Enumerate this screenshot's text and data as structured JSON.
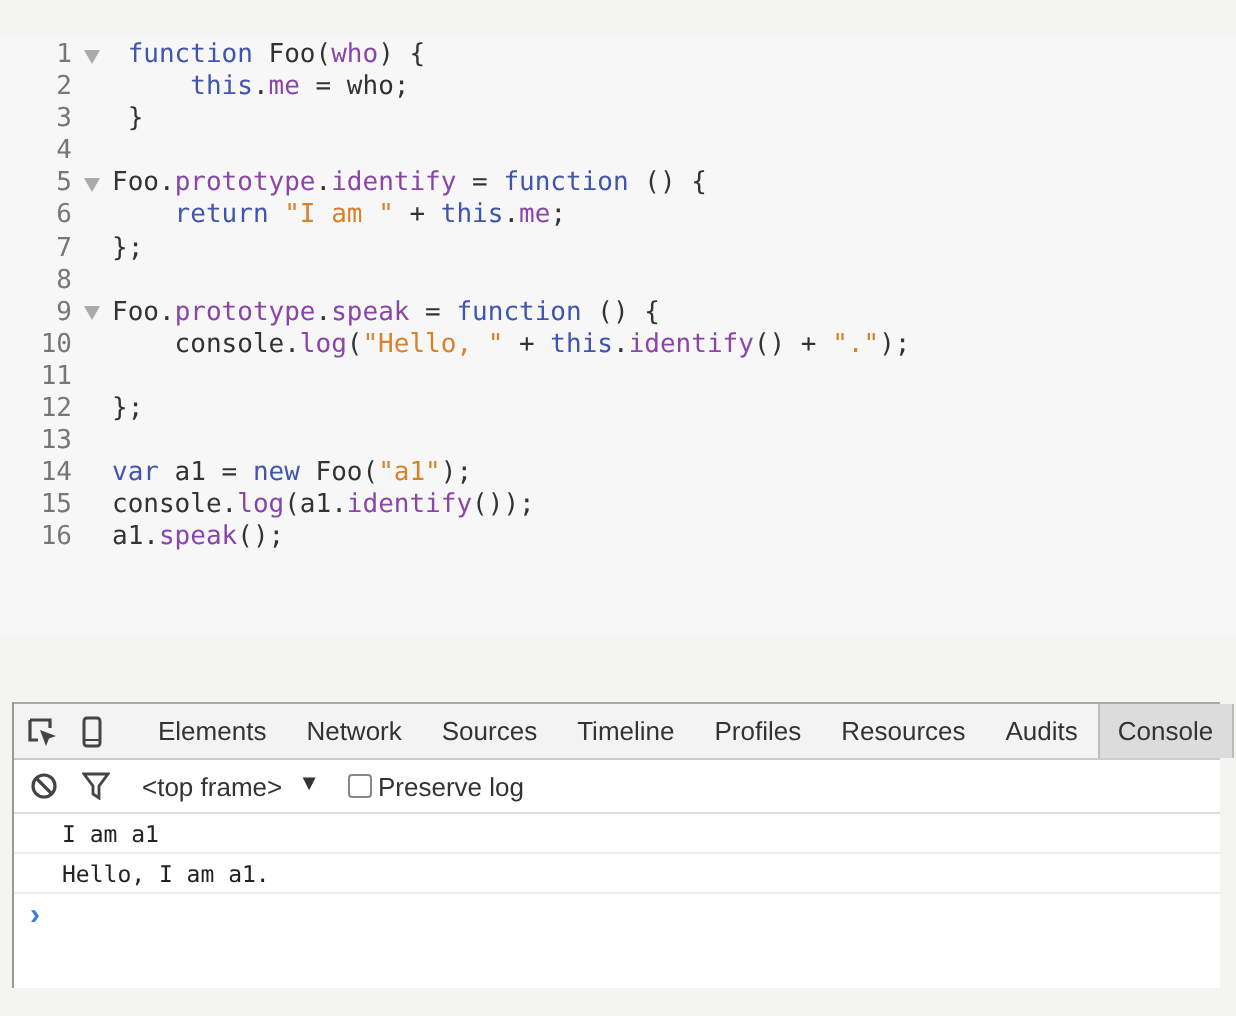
{
  "editor": {
    "lines": [
      {
        "number": "1",
        "foldable": true,
        "tokens": [
          {
            "kind": "keyword",
            "text": " function"
          },
          {
            "kind": "plain",
            "text": " Foo("
          },
          {
            "kind": "property",
            "text": "who"
          },
          {
            "kind": "plain",
            "text": ") {"
          }
        ]
      },
      {
        "number": "2",
        "foldable": false,
        "tokens": [
          {
            "kind": "keyword",
            "text": "     this"
          },
          {
            "kind": "plain",
            "text": "."
          },
          {
            "kind": "property",
            "text": "me"
          },
          {
            "kind": "plain",
            "text": " = who;"
          }
        ]
      },
      {
        "number": "3",
        "foldable": false,
        "tokens": [
          {
            "kind": "plain",
            "text": " }"
          }
        ]
      },
      {
        "number": "4",
        "foldable": false
      },
      {
        "number": "5",
        "foldable": true,
        "tokens": [
          {
            "kind": "plain",
            "text": "Foo."
          },
          {
            "kind": "property",
            "text": "prototype"
          },
          {
            "kind": "plain",
            "text": "."
          },
          {
            "kind": "property",
            "text": "identify"
          },
          {
            "kind": "plain",
            "text": " = "
          },
          {
            "kind": "keyword",
            "text": "function"
          },
          {
            "kind": "plain",
            "text": " () {"
          }
        ]
      },
      {
        "number": "6",
        "foldable": false,
        "tokens": [
          {
            "kind": "keyword",
            "text": "    return"
          },
          {
            "kind": "string",
            "text": " \"I am \""
          },
          {
            "kind": "plain",
            "text": " + "
          },
          {
            "kind": "keyword",
            "text": "this"
          },
          {
            "kind": "plain",
            "text": "."
          },
          {
            "kind": "property",
            "text": "me"
          },
          {
            "kind": "plain",
            "text": ";"
          }
        ]
      },
      {
        "number": "7",
        "foldable": false,
        "tokens": [
          {
            "kind": "plain",
            "text": "};"
          }
        ]
      },
      {
        "number": "8",
        "foldable": false
      },
      {
        "number": "9",
        "foldable": true,
        "tokens": [
          {
            "kind": "plain",
            "text": "Foo."
          },
          {
            "kind": "property",
            "text": "prototype"
          },
          {
            "kind": "plain",
            "text": "."
          },
          {
            "kind": "property",
            "text": "speak"
          },
          {
            "kind": "plain",
            "text": " = "
          },
          {
            "kind": "keyword",
            "text": "function"
          },
          {
            "kind": "plain",
            "text": " () {"
          }
        ]
      },
      {
        "number": "10",
        "foldable": false,
        "tokens": [
          {
            "kind": "plain",
            "text": "    console."
          },
          {
            "kind": "property",
            "text": "log"
          },
          {
            "kind": "plain",
            "text": "("
          },
          {
            "kind": "string",
            "text": "\"Hello, \""
          },
          {
            "kind": "plain",
            "text": " + "
          },
          {
            "kind": "keyword",
            "text": "this"
          },
          {
            "kind": "plain",
            "text": "."
          },
          {
            "kind": "property",
            "text": "identify"
          },
          {
            "kind": "plain",
            "text": "() + "
          },
          {
            "kind": "string",
            "text": "\".\""
          },
          {
            "kind": "plain",
            "text": ");"
          }
        ]
      },
      {
        "number": "11",
        "foldable": false
      },
      {
        "number": "12",
        "foldable": false,
        "tokens": [
          {
            "kind": "plain",
            "text": "};"
          }
        ]
      },
      {
        "number": "13",
        "foldable": false
      },
      {
        "number": "14",
        "foldable": false,
        "tokens": [
          {
            "kind": "keyword",
            "text": "var"
          },
          {
            "kind": "plain",
            "text": " a1 = "
          },
          {
            "kind": "keyword",
            "text": "new"
          },
          {
            "kind": "plain",
            "text": " Foo("
          },
          {
            "kind": "string",
            "text": "\"a1\""
          },
          {
            "kind": "plain",
            "text": ");"
          }
        ]
      },
      {
        "number": "15",
        "foldable": false,
        "tokens": [
          {
            "kind": "plain",
            "text": "console."
          },
          {
            "kind": "property",
            "text": "log"
          },
          {
            "kind": "plain",
            "text": "(a1."
          },
          {
            "kind": "property",
            "text": "identify"
          },
          {
            "kind": "plain",
            "text": "());"
          }
        ]
      },
      {
        "number": "16",
        "foldable": false,
        "tokens": [
          {
            "kind": "plain",
            "text": "a1."
          },
          {
            "kind": "property",
            "text": "speak"
          },
          {
            "kind": "plain",
            "text": "();"
          }
        ]
      }
    ]
  },
  "devtools": {
    "tabs": [
      {
        "label": "Elements",
        "selected": false
      },
      {
        "label": "Network",
        "selected": false
      },
      {
        "label": "Sources",
        "selected": false
      },
      {
        "label": "Timeline",
        "selected": false
      },
      {
        "label": "Profiles",
        "selected": false
      },
      {
        "label": "Resources",
        "selected": false
      },
      {
        "label": "Audits",
        "selected": false
      },
      {
        "label": "Console",
        "selected": true
      }
    ],
    "toolbar": {
      "context": "<top frame>",
      "context_caret": "▼",
      "preserve_log": {
        "label": "Preserve log",
        "checked": false
      }
    },
    "messages": [
      "I am a1",
      "Hello, I am a1."
    ],
    "prompt": "›"
  }
}
